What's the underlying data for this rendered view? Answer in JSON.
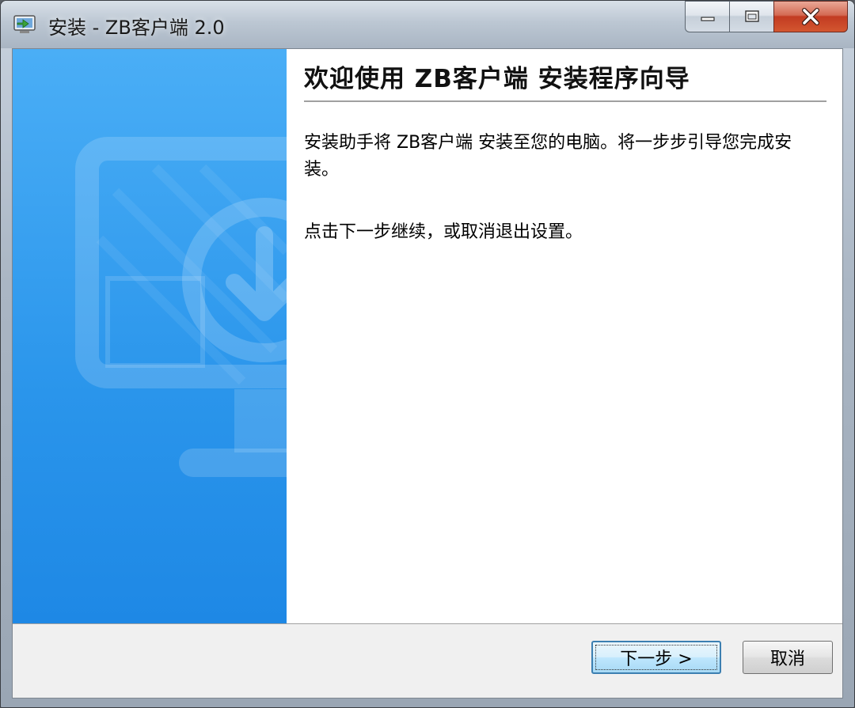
{
  "window": {
    "title": "安装 - ZB客户端 2.0"
  },
  "content": {
    "heading": "欢迎使用 ZB客户端 安装程序向导",
    "paragraph1": "安装助手将 ZB客户端 安装至您的电脑。将一步步引导您完成安装。",
    "paragraph2": "点击下一步继续，或取消退出设置。"
  },
  "buttons": {
    "next_label": "下一步 >",
    "cancel_label": "取消"
  },
  "icons": {
    "app": "installer-icon",
    "minimize": "minimize-icon",
    "maximize": "maximize-icon",
    "close": "close-icon",
    "sidebar_art": "monitor-download-icon"
  },
  "colors": {
    "sidebar_top": "#4aaef6",
    "sidebar_bottom": "#1e88e5",
    "close_button": "#c23b22",
    "default_button_border": "#3c7fb1"
  }
}
